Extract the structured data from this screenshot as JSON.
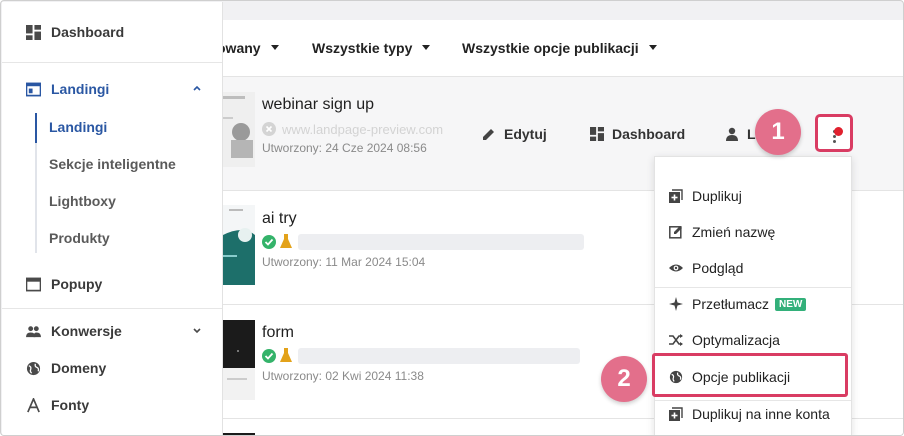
{
  "sidebar": {
    "items": [
      {
        "label": "Dashboard",
        "icon": "dashboard-icon"
      },
      {
        "label": "Landingi",
        "icon": "landing-page-icon"
      },
      {
        "label": "Popupy",
        "icon": "popup-icon"
      },
      {
        "label": "Konwersje",
        "icon": "people-icon"
      },
      {
        "label": "Domeny",
        "icon": "globe-icon"
      },
      {
        "label": "Fonty",
        "icon": "font-icon"
      }
    ],
    "subitems": [
      "Landingi",
      "Sekcje inteligentne",
      "Lightboxy",
      "Produkty"
    ]
  },
  "filters": {
    "status": "owany",
    "types": "Wszystkie typy",
    "publish_options": "Wszystkie opcje publikacji"
  },
  "rows": [
    {
      "title": "webinar sign up",
      "url": "www.landpage-preview.com",
      "date": "Utworzony: 24 Cze 2024 08:56"
    },
    {
      "title": "ai try",
      "url": "",
      "date": "Utworzony: 11 Mar 2024 15:04"
    },
    {
      "title": "form",
      "url": "",
      "date": "Utworzony: 02 Kwi 2024 11:38"
    }
  ],
  "row_actions": {
    "edit": "Edytuj",
    "dashboard": "Dashboard",
    "leads_partial": "L"
  },
  "menu": {
    "items": [
      {
        "label": "Duplikuj",
        "icon": "duplicate-icon"
      },
      {
        "label": "Zmień nazwę",
        "icon": "rename-icon"
      },
      {
        "label": "Podgląd",
        "icon": "eye-icon"
      },
      {
        "label": "Przetłumacz",
        "icon": "sparkle-icon",
        "badge": "NEW"
      },
      {
        "label": "Optymalizacja",
        "icon": "shuffle-icon"
      },
      {
        "label": "Opcje publikacji",
        "icon": "globe-icon"
      },
      {
        "label": "Duplikuj na inne konta",
        "icon": "duplicate-icon"
      }
    ]
  },
  "callouts": [
    "1",
    "2"
  ],
  "colors": {
    "accent": "#2a57a3",
    "highlight": "#d93c63",
    "callout": "#e36f8b",
    "badge": "#33b07a"
  }
}
